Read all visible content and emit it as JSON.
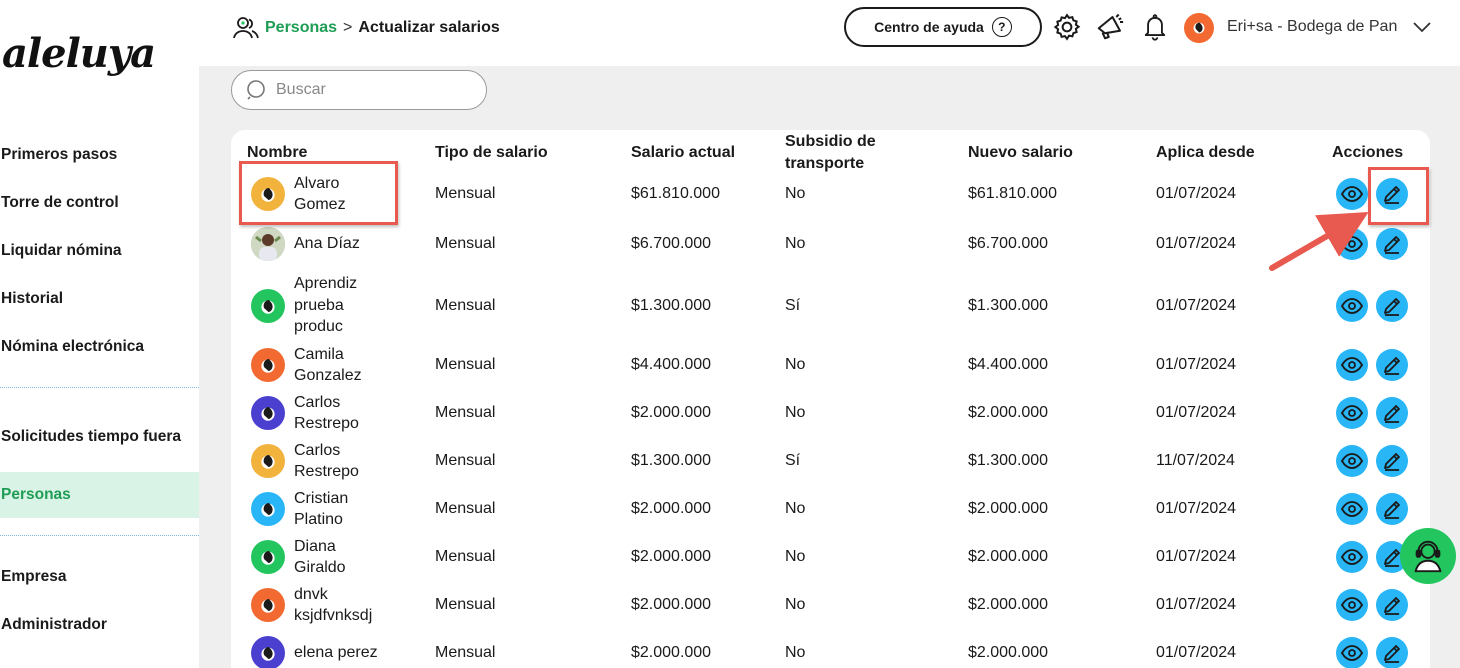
{
  "app": {
    "logo": "aleluya"
  },
  "sidebar": {
    "items": [
      {
        "label": "Primeros pasos"
      },
      {
        "label": "Torre de control"
      },
      {
        "label": "Liquidar nómina"
      },
      {
        "label": "Historial"
      },
      {
        "label": "Nómina electrónica"
      },
      {
        "label": "Solicitudes tiempo fuera"
      },
      {
        "label": "Personas",
        "active": true
      },
      {
        "label": "Empresa"
      },
      {
        "label": "Administrador"
      }
    ]
  },
  "header": {
    "breadcrumb": {
      "link": "Personas",
      "separator": ">",
      "current": "Actualizar salarios"
    },
    "help_label": "Centro de ayuda",
    "help_symbol": "?",
    "user_name": "Eri+sa - Bodega de Pan"
  },
  "search": {
    "placeholder": "Buscar"
  },
  "table": {
    "headers": {
      "nombre": "Nombre",
      "tipo": "Tipo de salario",
      "actual": "Salario actual",
      "subsidio": "Subsidio de transporte",
      "nuevo": "Nuevo salario",
      "aplica": "Aplica desde",
      "acciones": "Acciones"
    },
    "rows": [
      {
        "name": "Alvaro Gomez",
        "tipo": "Mensual",
        "actual": "$61.810.000",
        "subsidio": "No",
        "nuevo": "$61.810.000",
        "aplica": "01/07/2024",
        "avatar_color": "#f2b33d"
      },
      {
        "name": "Ana Díaz",
        "tipo": "Mensual",
        "actual": "$6.700.000",
        "subsidio": "No",
        "nuevo": "$6.700.000",
        "aplica": "01/07/2024",
        "avatar_color": "#8aa57a"
      },
      {
        "name": "Aprendiz prueba produc",
        "tipo": "Mensual",
        "actual": "$1.300.000",
        "subsidio": "Sí",
        "nuevo": "$1.300.000",
        "aplica": "01/07/2024",
        "avatar_color": "#22c55e"
      },
      {
        "name": "Camila Gonzalez",
        "tipo": "Mensual",
        "actual": "$4.400.000",
        "subsidio": "No",
        "nuevo": "$4.400.000",
        "aplica": "01/07/2024",
        "avatar_color": "#f26a32"
      },
      {
        "name": "Carlos Restrepo",
        "tipo": "Mensual",
        "actual": "$2.000.000",
        "subsidio": "No",
        "nuevo": "$2.000.000",
        "aplica": "01/07/2024",
        "avatar_color": "#4b3fd0"
      },
      {
        "name": "Carlos Restrepo",
        "tipo": "Mensual",
        "actual": "$1.300.000",
        "subsidio": "Sí",
        "nuevo": "$1.300.000",
        "aplica": "11/07/2024",
        "avatar_color": "#f2b33d"
      },
      {
        "name": "Cristian Platino",
        "tipo": "Mensual",
        "actual": "$2.000.000",
        "subsidio": "No",
        "nuevo": "$2.000.000",
        "aplica": "01/07/2024",
        "avatar_color": "#29b6f6"
      },
      {
        "name": "Diana Giraldo",
        "tipo": "Mensual",
        "actual": "$2.000.000",
        "subsidio": "No",
        "nuevo": "$2.000.000",
        "aplica": "01/07/2024",
        "avatar_color": "#22c55e"
      },
      {
        "name": "dnvk ksjdfvnksdj",
        "tipo": "Mensual",
        "actual": "$2.000.000",
        "subsidio": "No",
        "nuevo": "$2.000.000",
        "aplica": "01/07/2024",
        "avatar_color": "#f26a32"
      },
      {
        "name": "elena perez",
        "tipo": "Mensual",
        "actual": "$2.000.000",
        "subsidio": "No",
        "nuevo": "$2.000.000",
        "aplica": "01/07/2024",
        "avatar_color": "#4b3fd0"
      }
    ]
  },
  "icons": {
    "view": "eye-icon",
    "edit": "pencil-icon",
    "settings": "gear-icon",
    "megaphone": "megaphone-icon",
    "notifications": "bell-icon",
    "chat": "support-agent-icon"
  },
  "colors": {
    "brand_green": "#1f9d55",
    "action_blue": "#29b6f6",
    "highlight_red": "#e85a4f",
    "active_bg": "#d9f4e6"
  }
}
